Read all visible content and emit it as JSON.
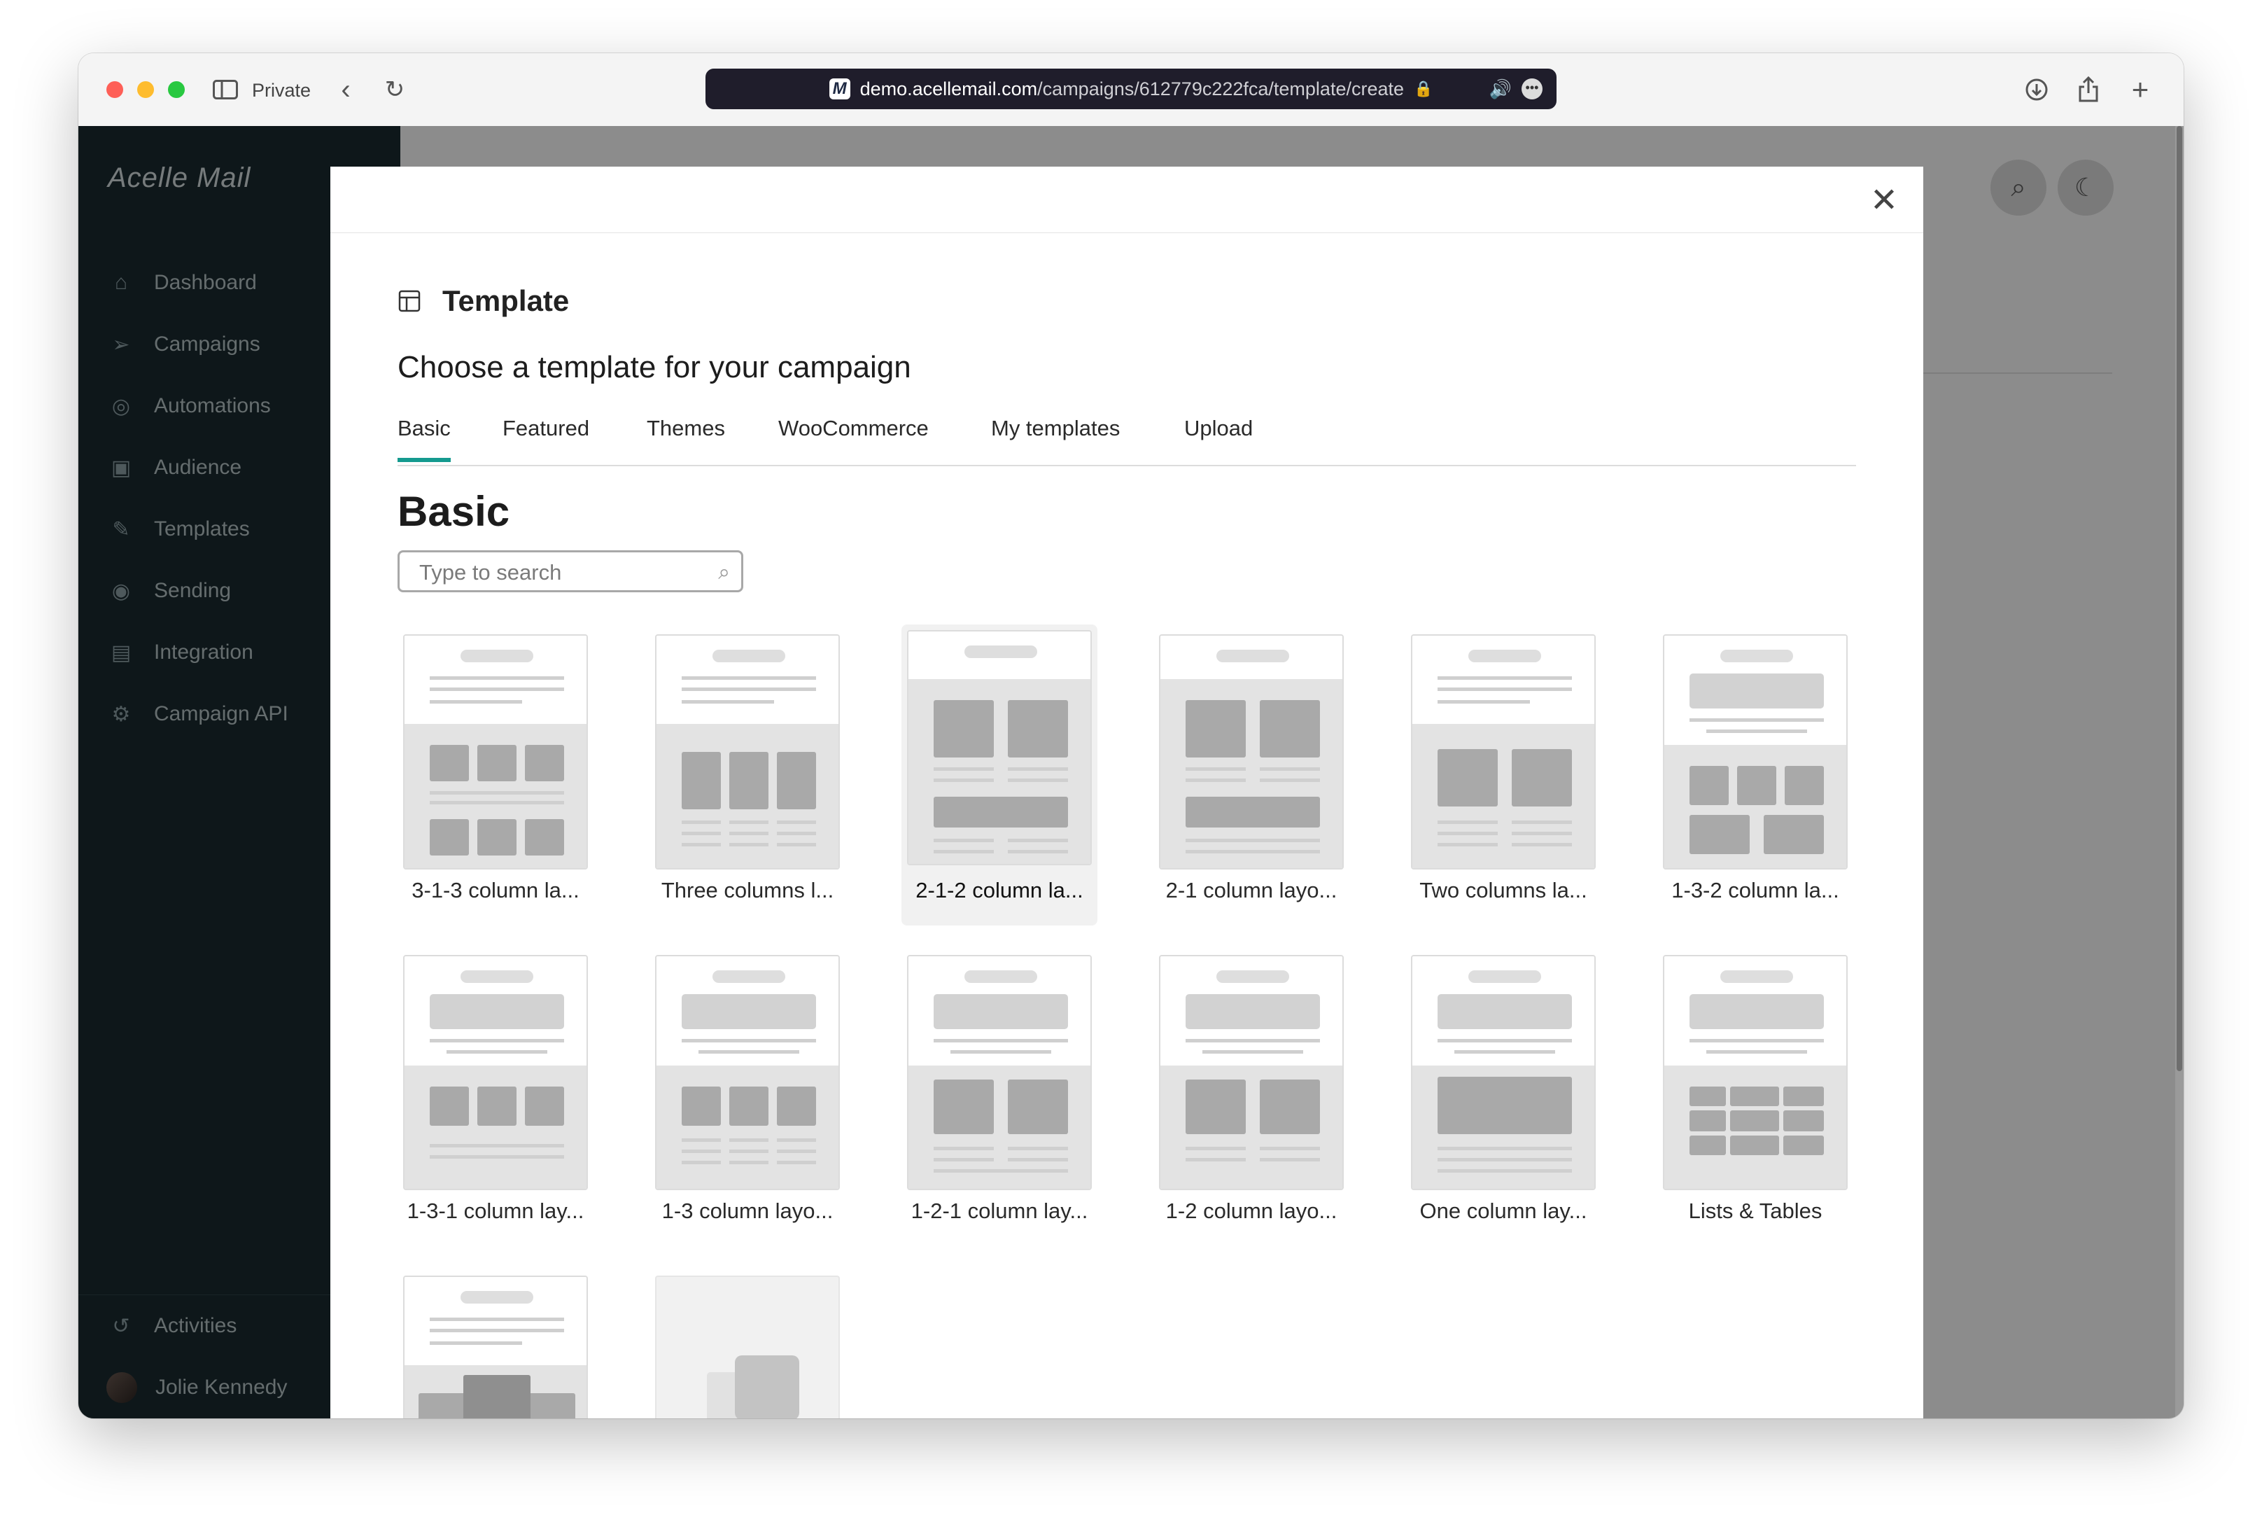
{
  "browser": {
    "private_label": "Private",
    "url_domain": "demo.acellemail.com",
    "url_path": "/campaigns/612779c222fca/template/create",
    "url_logo": "M"
  },
  "sidebar": {
    "logo": "Acelle Mail",
    "items": [
      {
        "label": "Dashboard",
        "icon": "home-icon"
      },
      {
        "label": "Campaigns",
        "icon": "send-icon"
      },
      {
        "label": "Automations",
        "icon": "automation-icon"
      },
      {
        "label": "Audience",
        "icon": "audience-icon"
      },
      {
        "label": "Templates",
        "icon": "edit-icon"
      },
      {
        "label": "Sending",
        "icon": "sending-icon"
      },
      {
        "label": "Integration",
        "icon": "integration-icon"
      },
      {
        "label": "Campaign API",
        "icon": "gear-icon"
      }
    ],
    "bottom": {
      "activities": "Activities",
      "user": "Jolie Kennedy"
    }
  },
  "modal": {
    "title": "Template",
    "subtitle": "Choose a template for your campaign",
    "tabs": [
      "Basic",
      "Featured",
      "Themes",
      "WooCommerce",
      "My templates",
      "Upload"
    ],
    "active_tab": "Basic",
    "section_title": "Basic",
    "search_placeholder": "Type to search",
    "templates": [
      "3-1-3 column la...",
      "Three columns l...",
      "2-1-2 column la...",
      "2-1 column layo...",
      "Two columns la...",
      "1-3-2 column la...",
      "1-3-1 column lay...",
      "1-3 column layo...",
      "1-2-1 column lay...",
      "1-2 column layo...",
      "One column lay...",
      "Lists & Tables"
    ],
    "selected_template": "2-1-2 column la..."
  },
  "colors": {
    "accent": "#159a8f",
    "sidebar_bg": "#1b2a30"
  }
}
